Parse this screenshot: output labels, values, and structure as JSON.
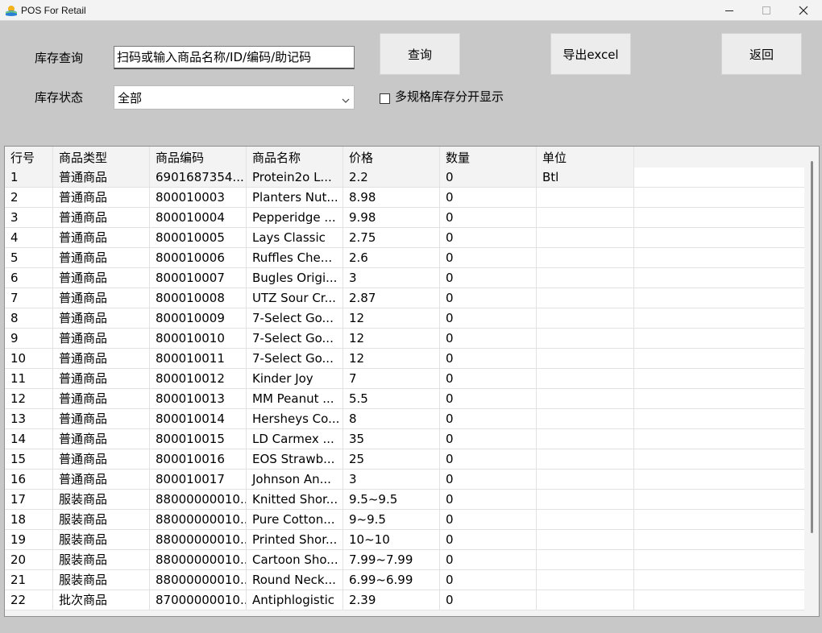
{
  "window": {
    "title": "POS For Retail",
    "icon": "app-logo-icon",
    "controls": [
      "minimize-icon",
      "maximize-icon",
      "close-icon"
    ]
  },
  "toolbar": {
    "query_label": "库存查询",
    "search_placeholder": "扫码或输入商品名称/ID/编码/助记码",
    "status_label": "库存状态",
    "status_value": "全部",
    "query_button": "查询",
    "export_button": "导出excel",
    "back_button": "返回",
    "multi_spec_checkbox_label": "多规格库存分开显示",
    "multi_spec_checked": false
  },
  "table": {
    "columns": [
      "行号",
      "商品类型",
      "商品编码",
      "商品名称",
      "价格",
      "数量",
      "单位"
    ],
    "rows": [
      [
        "1",
        "普通商品",
        "6901687354...",
        "Protein2o L...",
        "2.2",
        "0",
        "Btl"
      ],
      [
        "2",
        "普通商品",
        "800010003",
        "Planters Nut...",
        "8.98",
        "0",
        ""
      ],
      [
        "3",
        "普通商品",
        "800010004",
        "Pepperidge ...",
        "9.98",
        "0",
        ""
      ],
      [
        "4",
        "普通商品",
        "800010005",
        "Lays Classic",
        "2.75",
        "0",
        ""
      ],
      [
        "5",
        "普通商品",
        "800010006",
        "Ruffles Che...",
        "2.6",
        "0",
        ""
      ],
      [
        "6",
        "普通商品",
        "800010007",
        "Bugles Origi...",
        "3",
        "0",
        ""
      ],
      [
        "7",
        "普通商品",
        "800010008",
        "UTZ Sour Cr...",
        "2.87",
        "0",
        ""
      ],
      [
        "8",
        "普通商品",
        "800010009",
        "7-Select Go...",
        "12",
        "0",
        ""
      ],
      [
        "9",
        "普通商品",
        "800010010",
        "7-Select Go...",
        "12",
        "0",
        ""
      ],
      [
        "10",
        "普通商品",
        "800010011",
        "7-Select Go...",
        "12",
        "0",
        ""
      ],
      [
        "11",
        "普通商品",
        "800010012",
        "Kinder Joy",
        "7",
        "0",
        ""
      ],
      [
        "12",
        "普通商品",
        "800010013",
        "MM Peanut ...",
        "5.5",
        "0",
        ""
      ],
      [
        "13",
        "普通商品",
        "800010014",
        "Hersheys Co...",
        "8",
        "0",
        ""
      ],
      [
        "14",
        "普通商品",
        "800010015",
        "LD Carmex ...",
        "35",
        "0",
        ""
      ],
      [
        "15",
        "普通商品",
        "800010016",
        "EOS Strawb...",
        "25",
        "0",
        ""
      ],
      [
        "16",
        "普通商品",
        "800010017",
        "Johnson An...",
        "3",
        "0",
        ""
      ],
      [
        "17",
        "服装商品",
        "88000000010...",
        "Knitted Shor...",
        "9.5~9.5",
        "0",
        ""
      ],
      [
        "18",
        "服装商品",
        "88000000010...",
        "Pure Cotton...",
        "9~9.5",
        "0",
        ""
      ],
      [
        "19",
        "服装商品",
        "88000000010...",
        "Printed Shor...",
        "10~10",
        "0",
        ""
      ],
      [
        "20",
        "服装商品",
        "88000000010...",
        "Cartoon Sho...",
        "7.99~7.99",
        "0",
        ""
      ],
      [
        "21",
        "服装商品",
        "88000000010...",
        "Round Neck...",
        "6.99~6.99",
        "0",
        ""
      ],
      [
        "22",
        "批次商品",
        "87000000010...",
        "Antiphlogistic",
        "2.39",
        "0",
        ""
      ]
    ]
  }
}
